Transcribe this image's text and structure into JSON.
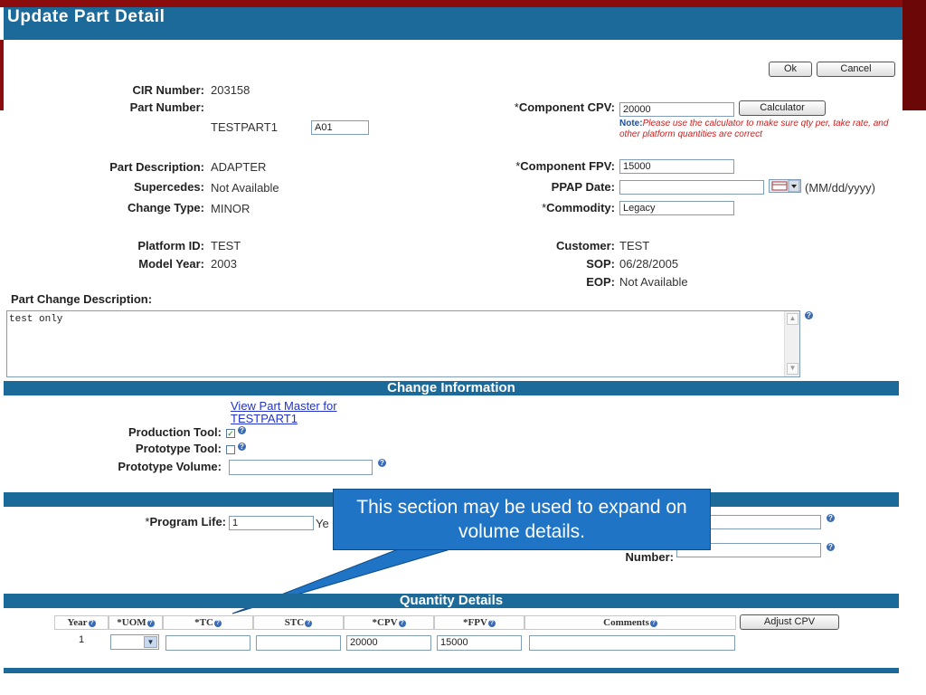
{
  "window": {
    "title": "Update Part Detail"
  },
  "actions": {
    "ok": "Ok",
    "cancel": "Cancel",
    "calculator": "Calculator",
    "adjust_cpv": "Adjust CPV"
  },
  "part": {
    "cir_number_label": "CIR Number:",
    "cir_number": "203158",
    "part_number_label": "Part Number:",
    "part_number": "TESTPART1",
    "revision": "A01",
    "description_label": "Part Description:",
    "description": "ADAPTER",
    "supercedes_label": "Supercedes:",
    "supercedes": "Not Available",
    "change_type_label": "Change Type:",
    "change_type": "MINOR",
    "platform_id_label": "Platform ID:",
    "platform_id": "TEST",
    "model_year_label": "Model Year:",
    "model_year": "2003"
  },
  "right": {
    "component_cpv_label": "Component CPV:",
    "component_cpv": "20000",
    "note_title": "Note:",
    "note_text": "Please use the calculator to make sure qty per, take rate, and other platform quantities are correct",
    "component_fpv_label": "Component FPV:",
    "component_fpv": "15000",
    "ppap_date_label": "PPAP Date:",
    "ppap_date": "",
    "date_format": "(MM/dd/yyyy)",
    "commodity_label": "Commodity:",
    "commodity": "Legacy",
    "customer_label": "Customer:",
    "customer": "TEST",
    "sop_label": "SOP:",
    "sop": "06/28/2005",
    "eop_label": "EOP:",
    "eop": "Not Available"
  },
  "change_desc": {
    "label": "Part Change Description:",
    "text": "test only"
  },
  "change_info": {
    "header": "Change Information",
    "view_link": "View Part Master for TESTPART1",
    "production_tool_label": "Production Tool:",
    "production_tool_checked": true,
    "prototype_tool_label": "Prototype Tool:",
    "prototype_tool_checked": false,
    "prototype_volume_label": "Prototype Volume:",
    "prototype_volume": ""
  },
  "program": {
    "program_life_label": "Program Life:",
    "program_life": "1",
    "program_life_unit_partial": "Ye",
    "number_label": "Number:",
    "number_value": ""
  },
  "callout": {
    "text": "This section may be used to expand on volume details."
  },
  "quantity": {
    "header": "Quantity Details",
    "columns": [
      "Year",
      "UOM",
      "TC",
      "STC",
      "CPV",
      "FPV",
      "Comments"
    ],
    "row": {
      "year": "1",
      "uom": "",
      "tc": "",
      "stc": "",
      "cpv": "20000",
      "fpv": "15000",
      "comments": ""
    }
  },
  "icons": {
    "help": "help-icon",
    "calendar": "calendar-icon",
    "dropdown": "chevron-down-icon"
  },
  "colors": {
    "header_blue": "#1b6a9a",
    "frame_red": "#8b0c0c",
    "callout_blue": "#1f74c6",
    "note_red": "#cc2020"
  }
}
